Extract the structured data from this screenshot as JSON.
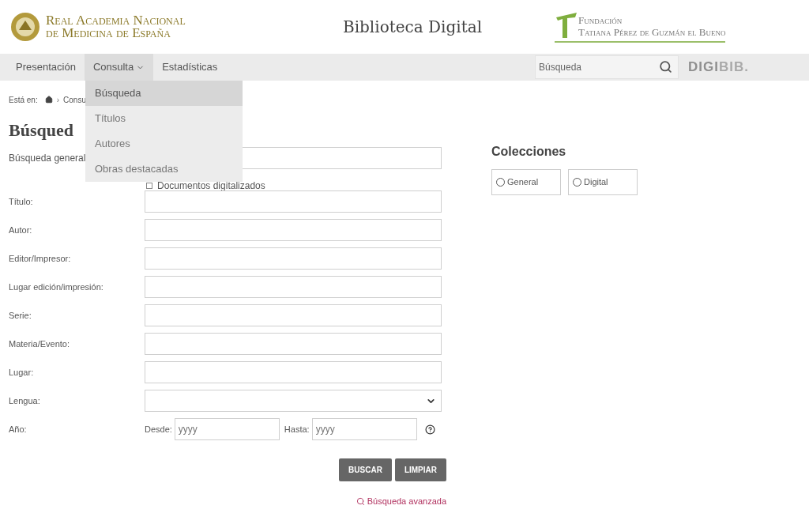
{
  "header": {
    "academy_lines": [
      "Real Academia Nacional",
      "de Medicina de España"
    ],
    "title": "Biblioteca Digital",
    "foundation_lines": [
      "Fundación",
      "Tatiana Pérez de Guzmán el Bueno"
    ]
  },
  "nav": {
    "items": [
      {
        "label": "Presentación",
        "selected": false,
        "has_menu": false
      },
      {
        "label": "Consulta",
        "selected": true,
        "has_menu": true
      },
      {
        "label": "Estadísticas",
        "selected": false,
        "has_menu": false
      }
    ],
    "search": {
      "placeholder": "Búsqueda"
    },
    "brand": [
      "DIGI",
      "BIB."
    ]
  },
  "dropdown": {
    "items": [
      {
        "label": "Búsqueda",
        "selected": true
      },
      {
        "label": "Títulos",
        "selected": false
      },
      {
        "label": "Autores",
        "selected": false
      },
      {
        "label": "Obras destacadas",
        "selected": false
      }
    ]
  },
  "breadcrumb": {
    "prefix": "Está en:",
    "separator": "›",
    "items": [
      "Consu"
    ]
  },
  "heading": "Búsqued",
  "form": {
    "general_label": "Búsqueda general",
    "digitized": {
      "label": "Documentos digitalizados",
      "checked": false
    },
    "fields": [
      {
        "label": "Título:",
        "kind": "text"
      },
      {
        "label": "Autor:",
        "kind": "text"
      },
      {
        "label": "Editor/Impresor:",
        "kind": "text"
      },
      {
        "label": "Lugar edición/impresión:",
        "kind": "text"
      },
      {
        "label": "Serie:",
        "kind": "text"
      },
      {
        "label": "Materia/Evento:",
        "kind": "text"
      },
      {
        "label": "Lugar:",
        "kind": "text"
      },
      {
        "label": "Lengua:",
        "kind": "select"
      }
    ],
    "year": {
      "label": "Año:",
      "from_label": "Desde:",
      "from_placeholder": "yyyy",
      "to_label": "Hasta:",
      "to_placeholder": "yyyy"
    },
    "buttons": [
      "BUSCAR",
      "LIMPIAR"
    ],
    "advanced_link": "Búsqueda avanzada"
  },
  "collections": {
    "title": "Colecciones",
    "options": [
      {
        "label": "General",
        "selected": false
      },
      {
        "label": "Digital",
        "selected": false
      }
    ]
  }
}
